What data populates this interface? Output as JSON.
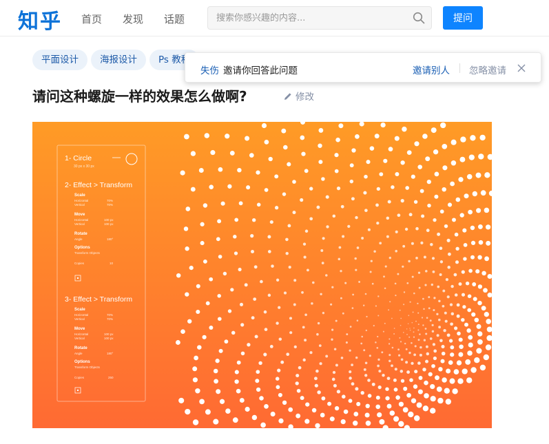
{
  "header": {
    "logo": "知乎",
    "nav": [
      "首页",
      "发现",
      "话题"
    ],
    "search_placeholder": "搜索你感兴趣的内容...",
    "ask_label": "提问",
    "brand_color": "#0e84ff"
  },
  "topics": [
    "平面设计",
    "海报设计",
    "Ps 教程"
  ],
  "invite_bar": {
    "inviter": "失伤",
    "message": "邀请你回答此问题",
    "invite_others": "邀请别人",
    "ignore": "忽略邀请"
  },
  "question": {
    "title": "请问这种螺旋一样的效果怎么做啊?",
    "edit_label": "修改"
  },
  "image_panel": {
    "background_colors": [
      "#ff9b26",
      "#ff6a33"
    ],
    "step1": {
      "title": "1- Circle",
      "subtitle": "30 px x 30 px"
    },
    "step2": {
      "title": "2- Effect > Transform",
      "scale_label": "Scale",
      "scale_rows": [
        [
          "Horizontal",
          "70%"
        ],
        [
          "Vertical",
          "70%"
        ]
      ],
      "move_label": "Move",
      "move_rows": [
        [
          "Horizontal",
          "100 px"
        ],
        [
          "Vertical",
          "100 px"
        ]
      ],
      "rotate_label": "Rotate",
      "rotate_rows": [
        [
          "Angle",
          "180°"
        ]
      ],
      "options_label": "Options",
      "options_value": "Transform Objects",
      "copies_label": "Copies",
      "copies_value": "10"
    },
    "step3": {
      "title": "3- Effect > Transform",
      "scale_label": "Scale",
      "scale_rows": [
        [
          "Horizontal",
          "70%"
        ],
        [
          "Vertical",
          "70%"
        ]
      ],
      "move_label": "Move",
      "move_rows": [
        [
          "Horizontal",
          "100 px"
        ],
        [
          "Vertical",
          "100 px"
        ]
      ],
      "rotate_label": "Rotate",
      "rotate_rows": [
        [
          "Angle",
          "180°"
        ]
      ],
      "options_label": "Options",
      "options_value": "Transform Objects",
      "copies_label": "Copies",
      "copies_value": "250"
    }
  }
}
